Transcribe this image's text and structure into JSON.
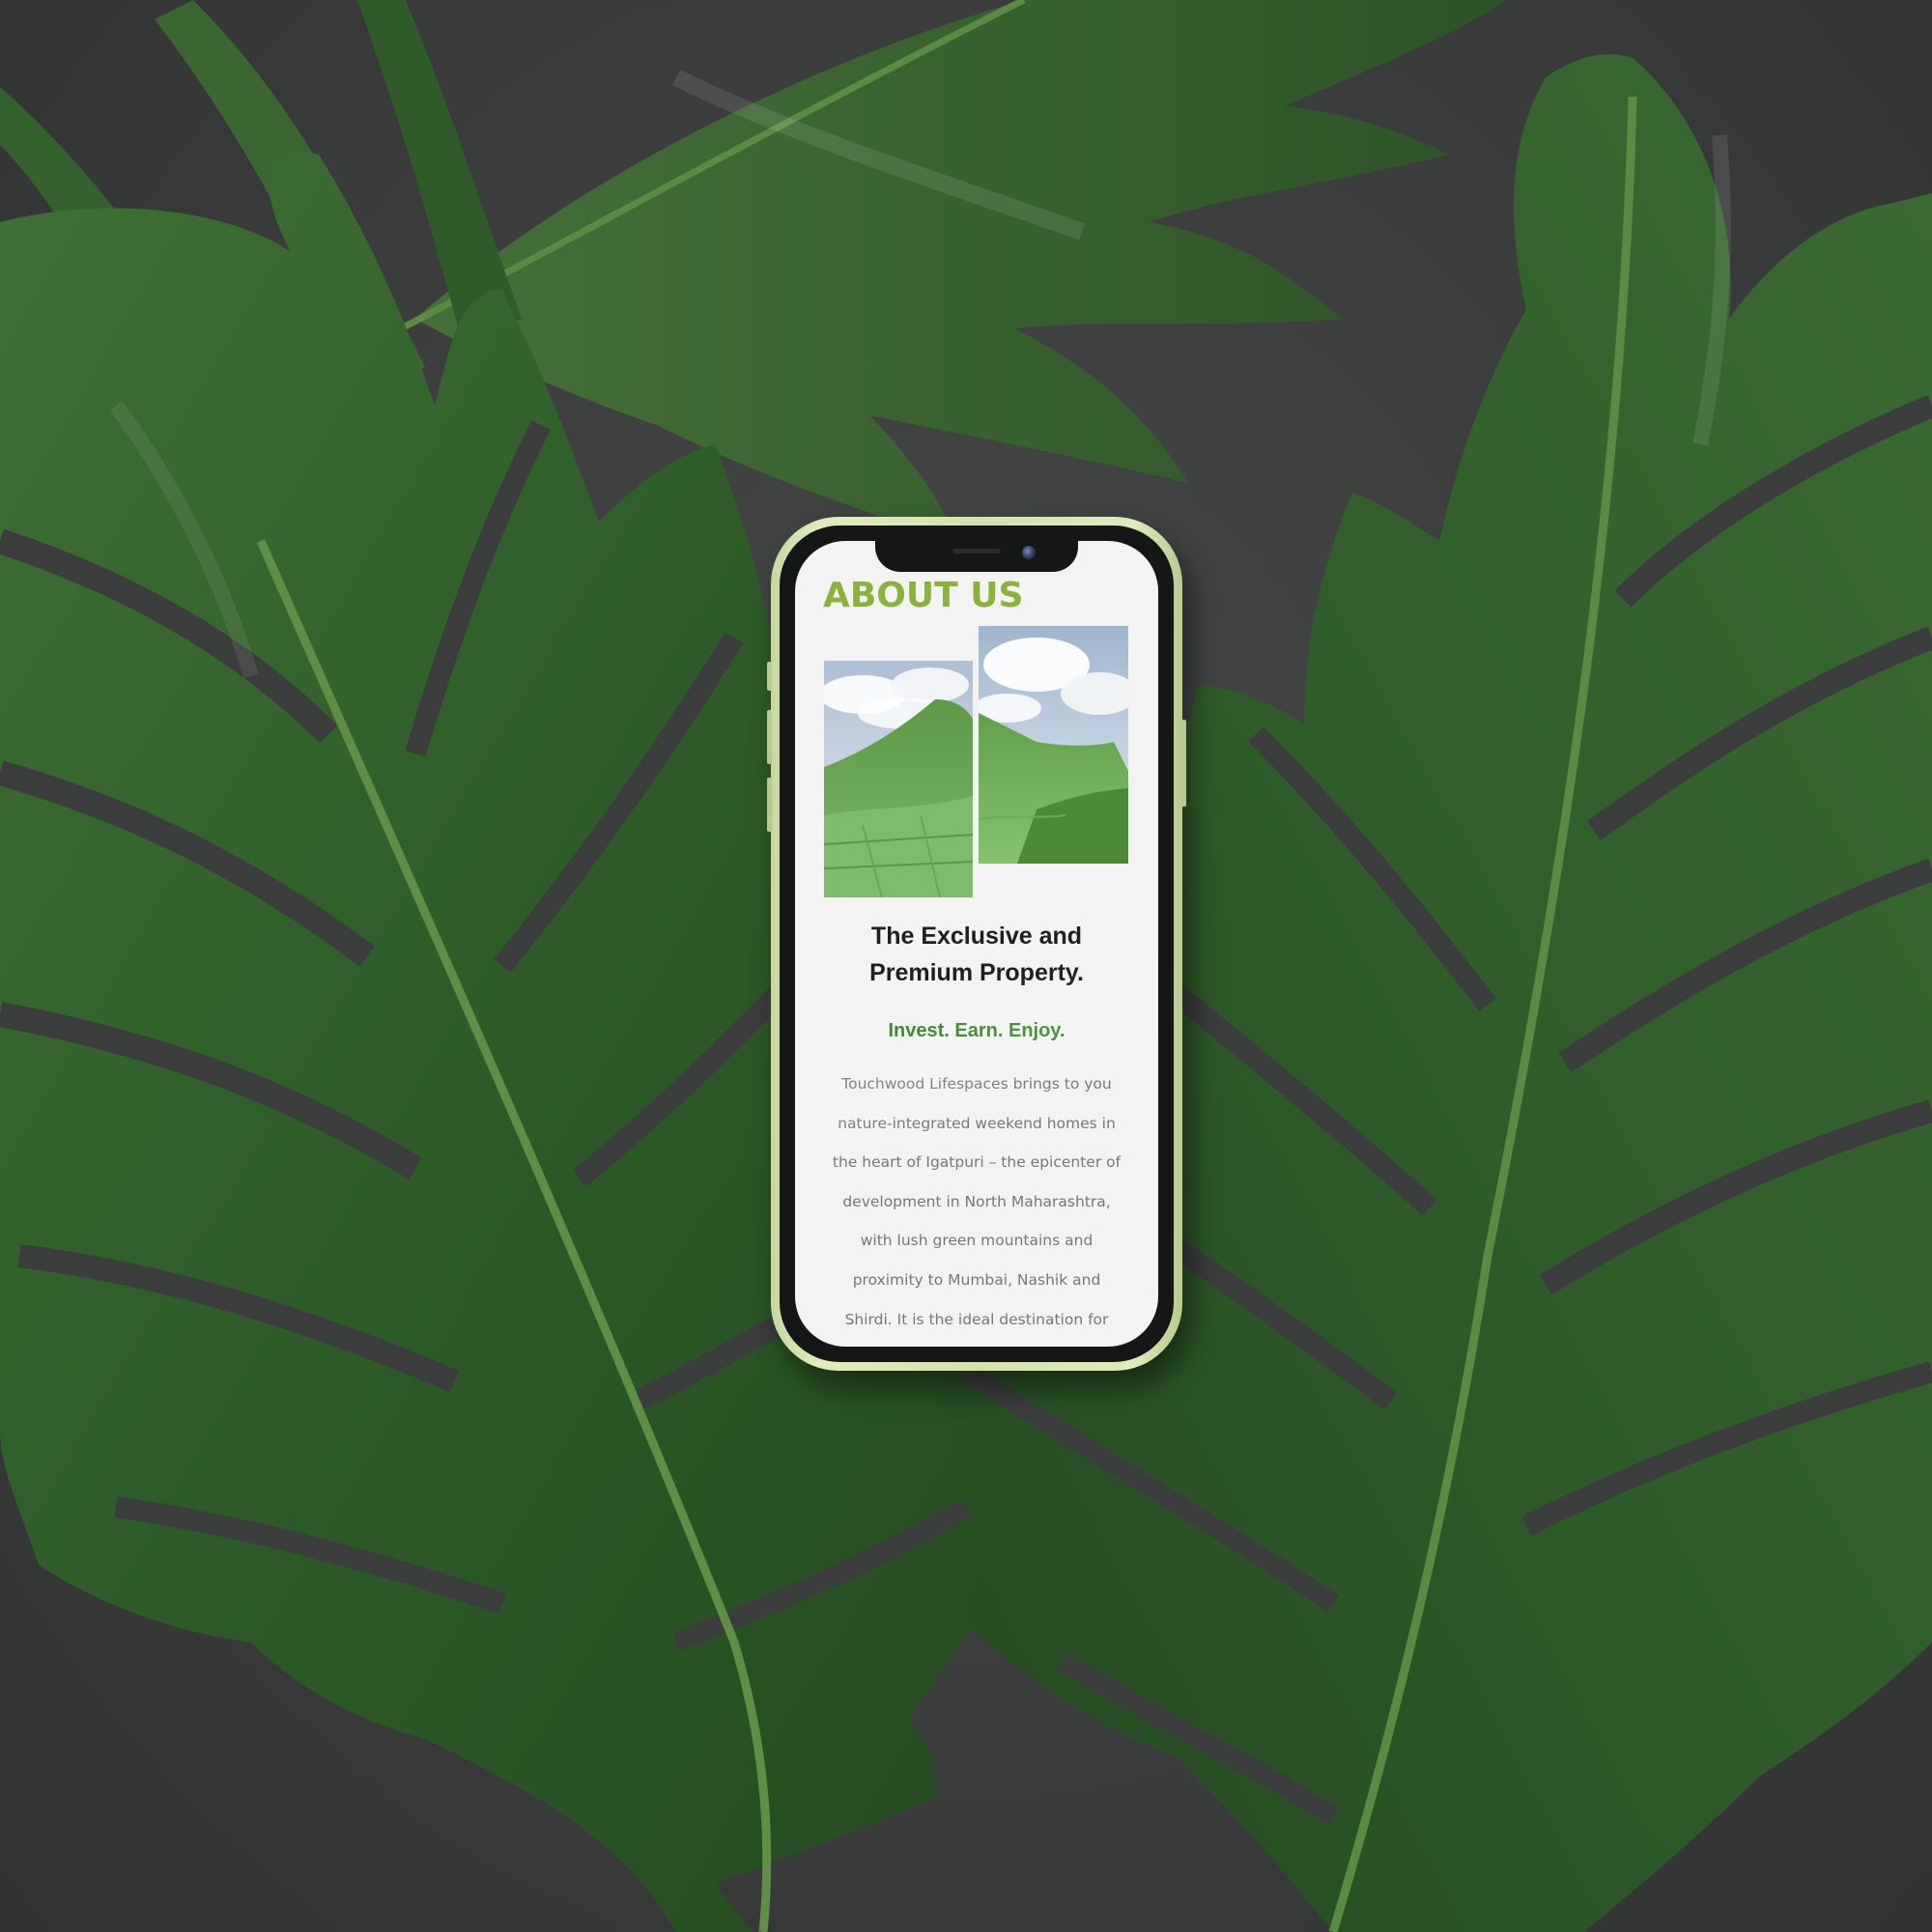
{
  "about": {
    "heading": "ABOUT US",
    "headline_line1": "The Exclusive and",
    "headline_line2": "Premium Property.",
    "tagline": "Invest. Earn. Enjoy.",
    "body_lines": [
      "Touchwood Lifespaces brings to you",
      "nature-integrated weekend homes in",
      "the heart of Igatpuri – the epicenter of",
      "development in North Maharashtra,",
      "with lush green mountains and",
      "proximity to Mumbai, Nashik and",
      "Shirdi. It is the ideal destination for"
    ]
  },
  "colors": {
    "accent_green": "#8bb23c",
    "tagline_green": "#3a8a2a",
    "phone_frame": "#d4e2ab",
    "background": "#3c3d3d",
    "leaf_green": "#2f5e2b"
  },
  "icons": {
    "camera": "front-camera-icon"
  }
}
